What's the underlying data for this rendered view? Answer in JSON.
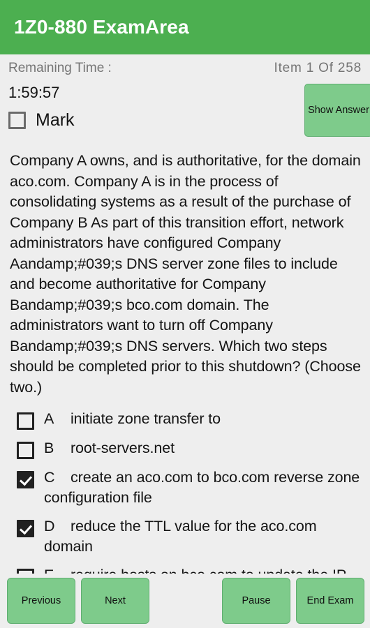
{
  "appbar": {
    "title": "1Z0-880 ExamArea"
  },
  "info": {
    "remaining_time_label": "Remaining Time :",
    "item_counter": "Item 1 Of 258"
  },
  "status": {
    "timer": "1:59:57",
    "mark_label": "Mark",
    "mark_checked": false,
    "show_answer_label": "Show Answer"
  },
  "question": {
    "text": "Company A owns, and is authoritative, for the domain aco.com. Company A is in the process of consolidating systems as a result of the purchase of Company B As part of this transition effort, network administrators have configured Company Aandamp;#039;s DNS server zone files to include and become authoritative for Company Bandamp;#039;s bco.com domain. The administrators want to turn off Company Bandamp;#039;s DNS servers. Which two steps should be completed prior to this shutdown? (Choose two.)"
  },
  "options": [
    {
      "letter": "A",
      "text": "initiate zone transfer to",
      "checked": false
    },
    {
      "letter": "B",
      "text": "root-servers.net",
      "checked": false
    },
    {
      "letter": "C",
      "text": "create an aco.com to bco.com reverse zone configuration file",
      "checked": true
    },
    {
      "letter": "D",
      "text": "reduce the TTL value for the aco.com domain",
      "checked": true
    },
    {
      "letter": "E",
      "text": "require hosts on bco.com to update the IP address used for DNS resolution",
      "checked": false
    }
  ],
  "bottombar": {
    "previous_label": "Previous",
    "next_label": "Next",
    "pause_label": "Pause",
    "end_exam_label": "End Exam"
  },
  "colors": {
    "appbar_green": "#4caf50",
    "button_green": "#7ecb8b",
    "button_border": "#5fae70",
    "page_background": "#eeeeee",
    "checkbox_checked": "#212121",
    "muted_text": "#757575"
  }
}
